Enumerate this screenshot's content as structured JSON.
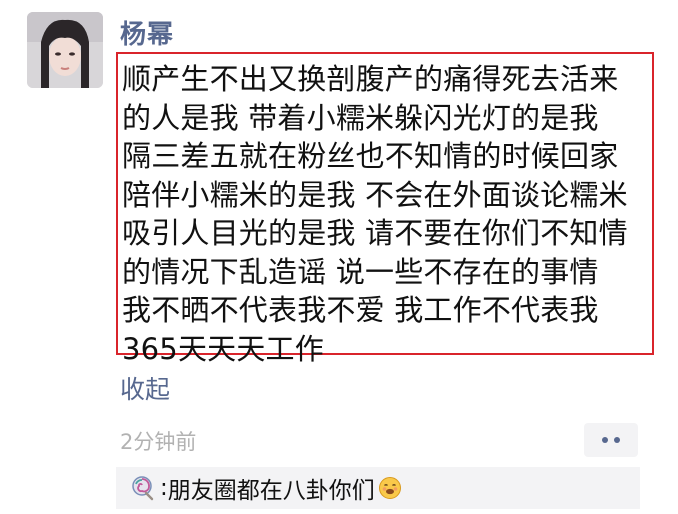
{
  "author": {
    "name": "杨幂"
  },
  "post": {
    "lines": [
      "顺产生不出又换剖腹产的痛得死去活来",
      "的人是我 带着小糯米躲闪光灯的是我",
      "隔三差五就在粉丝也不知情的时候回家",
      "陪伴小糯米的是我 不会在外面谈论糯米",
      "吸引人目光的是我 请不要在你们不知情",
      "的情况下乱造谣 说一些不存在的事情",
      "我不晒不代表我不爱 我工作不代表我",
      "365天天天工作"
    ],
    "collapse_label": "收起",
    "time": "2分钟前"
  },
  "comments": [
    {
      "icon": "lollipop-icon",
      "separator": ":",
      "text": "朋友圈都在八卦你们",
      "emoji": "face-emoji-icon"
    }
  ],
  "colors": {
    "accent": "#57688f",
    "highlight_border": "#d9242b"
  }
}
